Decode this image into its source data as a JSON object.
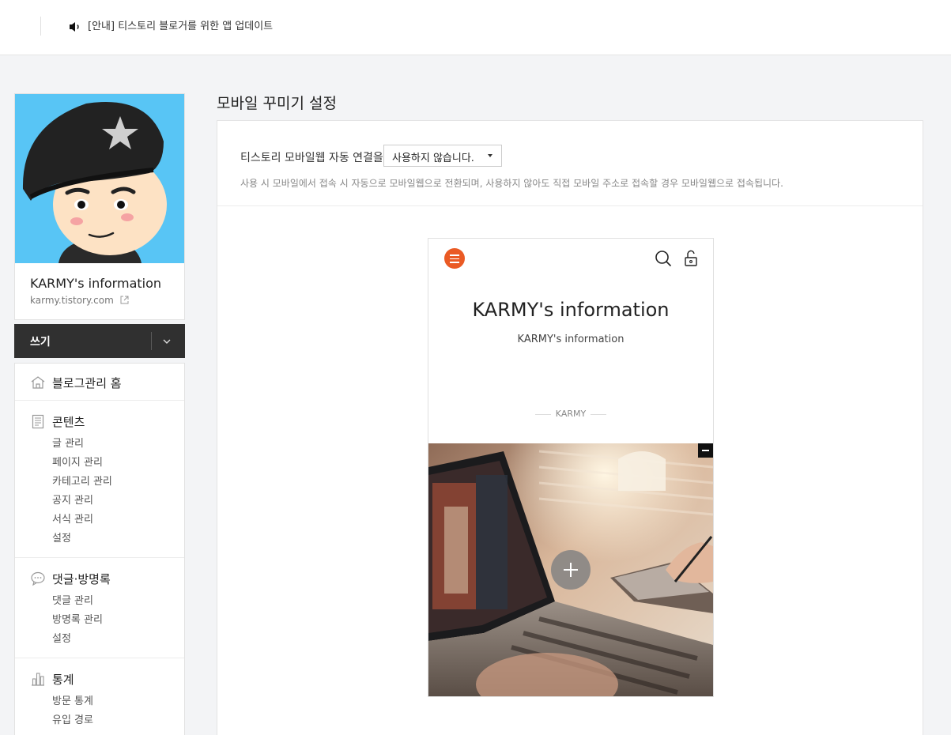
{
  "notice": {
    "text": "[안내] 티스토리 블로거를 위한 앱 업데이트",
    "icon": "speaker-icon"
  },
  "profile": {
    "name": "KARMY's information",
    "url": "karmy.tistory.com"
  },
  "write": {
    "label": "쓰기"
  },
  "menu": {
    "home": {
      "label": "블로그관리 홈",
      "icon": "home-icon"
    },
    "content": {
      "label": "콘텐츠",
      "icon": "document-icon",
      "items": [
        "글 관리",
        "페이지 관리",
        "카테고리 관리",
        "공지 관리",
        "서식 관리",
        "설정"
      ]
    },
    "comments": {
      "label": "댓글·방명록",
      "icon": "speech-bubble-icon",
      "items": [
        "댓글 관리",
        "방명록 관리",
        "설정"
      ]
    },
    "stats": {
      "label": "통계",
      "icon": "bar-chart-icon",
      "items": [
        "방문 통계",
        "유입 경로"
      ]
    }
  },
  "page": {
    "title": "모바일 꾸미기 설정",
    "setting_label": "티스토리 모바일웹 자동 연결을",
    "select_value": "사용하지 않습니다.",
    "description": "사용 시 모바일에서 접속 시 자동으로 모바일웹으로 전환되며, 사용하지 않아도 직접 모바일 주소로 접속할 경우 모바일웹으로 접속됩니다."
  },
  "preview": {
    "blog_title": "KARMY's information",
    "blog_subtitle": "KARMY's information",
    "author": "KARMY",
    "accent": "#ea5a24"
  }
}
